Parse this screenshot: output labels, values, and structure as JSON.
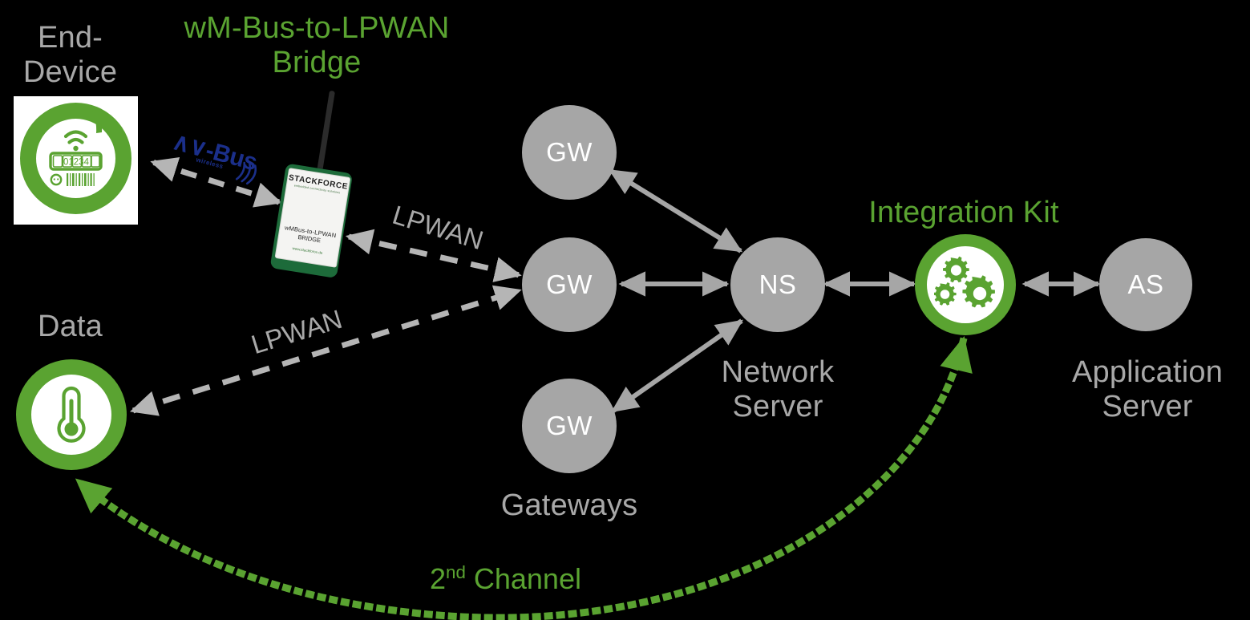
{
  "diagram": {
    "title_visible": false,
    "background": "#000000",
    "colors": {
      "green": "#5aa331",
      "grey_node": "#a6a6a6",
      "grey_text": "#a8a8a8",
      "mbus_blue": "#1b2f8a",
      "white": "#ffffff",
      "bridge_green": "#1d6b3a"
    }
  },
  "labels": {
    "end_device": "End-\nDevice",
    "bridge_title": "wM-Bus-to-LPWAN\nBridge",
    "data": "Data",
    "gateways": "Gateways",
    "network_server": "Network\nServer",
    "integration_kit": "Integration Kit",
    "application_server": "Application\nServer",
    "second_channel_prefix": "2",
    "second_channel_sup": "nd",
    "second_channel_suffix": " Channel"
  },
  "nodes": [
    {
      "id": "gw-top",
      "text": "GW",
      "name": "gateway-top"
    },
    {
      "id": "gw-middle",
      "text": "GW",
      "name": "gateway-middle"
    },
    {
      "id": "gw-bottom",
      "text": "GW",
      "name": "gateway-bottom"
    },
    {
      "id": "ns",
      "text": "NS",
      "name": "network-server-node"
    },
    {
      "id": "as",
      "text": "AS",
      "name": "application-server-node"
    }
  ],
  "end_device_icon": {
    "type": "smart-meter-icon",
    "digits": "01234",
    "has_wifi_arcs": true,
    "has_barcode": true
  },
  "data_icon": {
    "type": "thermometer-icon"
  },
  "integration_kit_icon": {
    "type": "gears-icon",
    "gear_count": 3
  },
  "bridge_device": {
    "brand": "STACKFORCE",
    "tagline": "embedded connectivity solutions",
    "model_line_1": "wMBus-to-LPWAN",
    "model_line_2": "BRIDGE",
    "url": "www.stackforce.de",
    "has_antenna": true
  },
  "connections": [
    {
      "id": "mbus",
      "label": "M-Bus",
      "style": "dashed",
      "color": "#a8a8a8",
      "from": "bridge",
      "to": "end-device",
      "arrow": "both"
    },
    {
      "id": "lpwan-1",
      "label": "LPWAN",
      "style": "dashed",
      "color": "#a8a8a8",
      "from": "bridge",
      "to": "gateway-middle",
      "arrow": "both"
    },
    {
      "id": "lpwan-2",
      "label": "LPWAN",
      "style": "dashed",
      "color": "#a8a8a8",
      "from": "data",
      "to": "gateway-middle",
      "arrow": "both"
    },
    {
      "id": "gw-top-ns",
      "label": "",
      "style": "solid",
      "color": "#a6a6a6",
      "from": "gateway-top",
      "to": "ns",
      "arrow": "both"
    },
    {
      "id": "gw-mid-ns",
      "label": "",
      "style": "solid",
      "color": "#a6a6a6",
      "from": "gateway-middle",
      "to": "ns",
      "arrow": "both"
    },
    {
      "id": "gw-bot-ns",
      "label": "",
      "style": "solid",
      "color": "#a6a6a6",
      "from": "gateway-bottom",
      "to": "ns",
      "arrow": "both"
    },
    {
      "id": "ns-ik",
      "label": "",
      "style": "solid",
      "color": "#a6a6a6",
      "from": "ns",
      "to": "integration-kit",
      "arrow": "both"
    },
    {
      "id": "ik-as",
      "label": "",
      "style": "solid",
      "color": "#a6a6a6",
      "from": "integration-kit",
      "to": "as",
      "arrow": "both"
    },
    {
      "id": "second-channel",
      "label": "2nd Channel",
      "style": "dotted",
      "color": "#5aa331",
      "from": "integration-kit",
      "to": "data",
      "arrow": "both"
    }
  ]
}
